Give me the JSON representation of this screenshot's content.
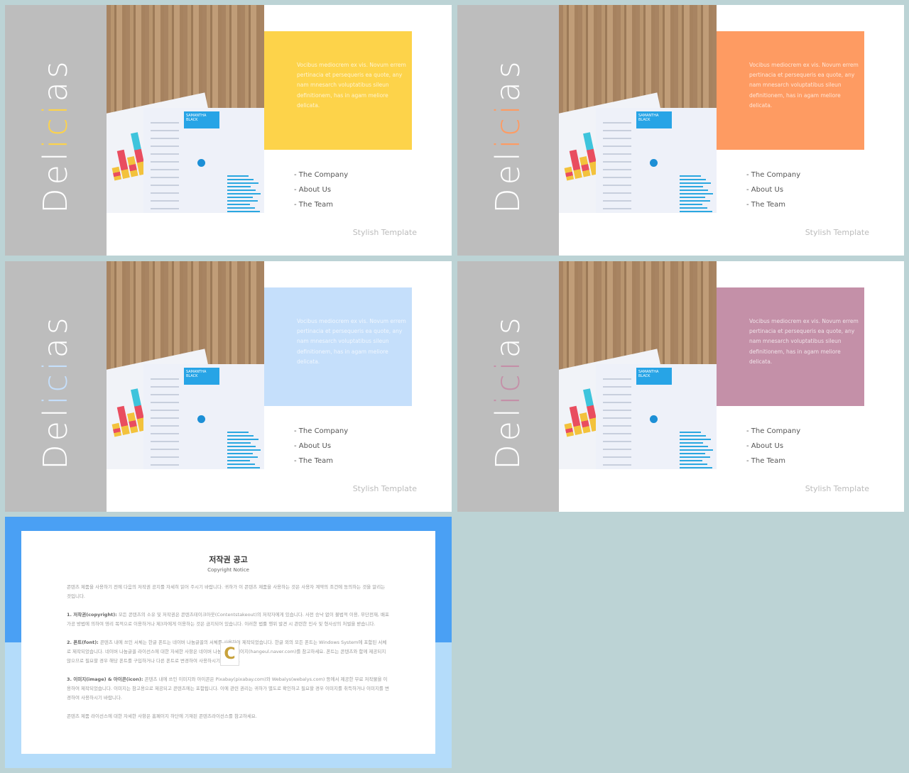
{
  "slides": [
    {
      "title_a": "Del",
      "title_b": "ici",
      "title_c": "as",
      "accent": "#fdd34a",
      "box": "#fdd34a",
      "box_text": "Vocibus mediocrem ex vis. Novum errem pertinacia et persequeris ea quote, any nam mnesarch voluptatibus sileun definitionem, has in agam meliore delicata.",
      "menu": [
        "- The Company",
        "- About  Us",
        "- The Team"
      ],
      "footer": "Stylish  Template",
      "resume_name": "SAMANTHA BLACK"
    },
    {
      "title_a": "Del",
      "title_b": "ici",
      "title_c": "as",
      "accent": "#fe9b62",
      "box": "#fe9b62",
      "box_text": "Vocibus mediocrem ex vis. Novum errem pertinacia et persequeris ea quote, any nam mnesarch voluptatibus sileun definitionem, has in agam meliore delicata.",
      "menu": [
        "- The Company",
        "- About  Us",
        "- The Team"
      ],
      "footer": "Stylish  Template",
      "resume_name": "SAMANTHA BLACK"
    },
    {
      "title_a": "Del",
      "title_b": "ici",
      "title_c": "as",
      "accent": "#c5dffb",
      "box": "#c5dffb",
      "box_text": "Vocibus mediocrem ex vis. Novum errem pertinacia et persequeris ea quote, any nam mnesarch voluptatibus sileun definitionem, has in agam meliore delicata.",
      "menu": [
        "- The Company",
        "- About  Us",
        "- The Team"
      ],
      "footer": "Stylish  Template",
      "resume_name": "SAMANTHA BLACK"
    },
    {
      "title_a": "Del",
      "title_b": "ici",
      "title_c": "as",
      "accent": "#c490a8",
      "box": "#c490a8",
      "box_text": "Vocibus mediocrem ex vis. Novum errem pertinacia et persequeris ea quote, any nam mnesarch voluptatibus sileun definitionem, has in agam meliore delicata.",
      "menu": [
        "- The Company",
        "- About  Us",
        "- The Team"
      ],
      "footer": "Stylish  Template",
      "resume_name": "SAMANTHA BLACK"
    }
  ],
  "notice": {
    "title": "저작권 공고",
    "subtitle": "Copyright Notice",
    "intro": "콘텐츠 제품을 사용하기 전에 다음의 저작권 공지를 자세히 읽어 주시기 바랍니다. 귀하가 이 콘텐츠 제품을 사용하는 것은 사용자 계약의 조건에 동의하는 것을 알리는 것입니다.",
    "p1_head": "1. 저작권(copyright):",
    "p1": " 모든 콘텐츠의 소유 및 저작권은 콘텐츠테이크아웃(Contentstakeout)의 저작자에게 있습니다. 사전 승낙 없이 불법적 이용, 무단전재, 배포 가공 방법에 의하여 영리 목적으로 이용하거나 제3자에게 이용하는 것은 금지되어 있습니다. 이러한 법률 행위 발견 시 관련한 민사 및 형사상의 처벌을 받습니다.",
    "p2_head": "2. 폰트(font):",
    "p2": " 콘텐츠 내에 쓰인 서체는 한글 폰트는 네이버 나눔글꼴의 서체를 사용하여 제작되었습니다. 한글 외의 모든 폰트는 Windows System에 포함된 서체로 제작되었습니다. 네이버 나눔글꼴 라이선스에 대한 자세한 사항은 네이버 나눔글꼴 홈페이지(hangeul.naver.com)를 참고하세요. 폰트는 콘텐츠와 함께 제공되지 않으므로 필요할 경우 해당 폰트를 구입하거나 다른 폰트로 변경하여 사용하시기 바랍니다.",
    "p3_head": "3. 이미지(image) & 아이콘(icon):",
    "p3": " 콘텐츠 내에 쓰인 이미지와 아이콘은 Pixabay(pixabay.com)와 Webalys(webalys.com) 등에서 제공한 무료 저작물을 이용하여 제작되었습니다. 이미지는 참고용으로 제공되고 콘텐츠에는 포함됩니다. 이에 관련 권리는 귀하가 별도로 확인하고 필요할 경우 이미지를 취득하거나 이미지를 변경하여 사용하시기 바랍니다.",
    "outro": "콘텐츠 제품 라이선스에 대한 자세한 사항은 홈페이지 하단에 기재된 콘텐츠라이선스를 참고하세요.",
    "logo": "C"
  }
}
